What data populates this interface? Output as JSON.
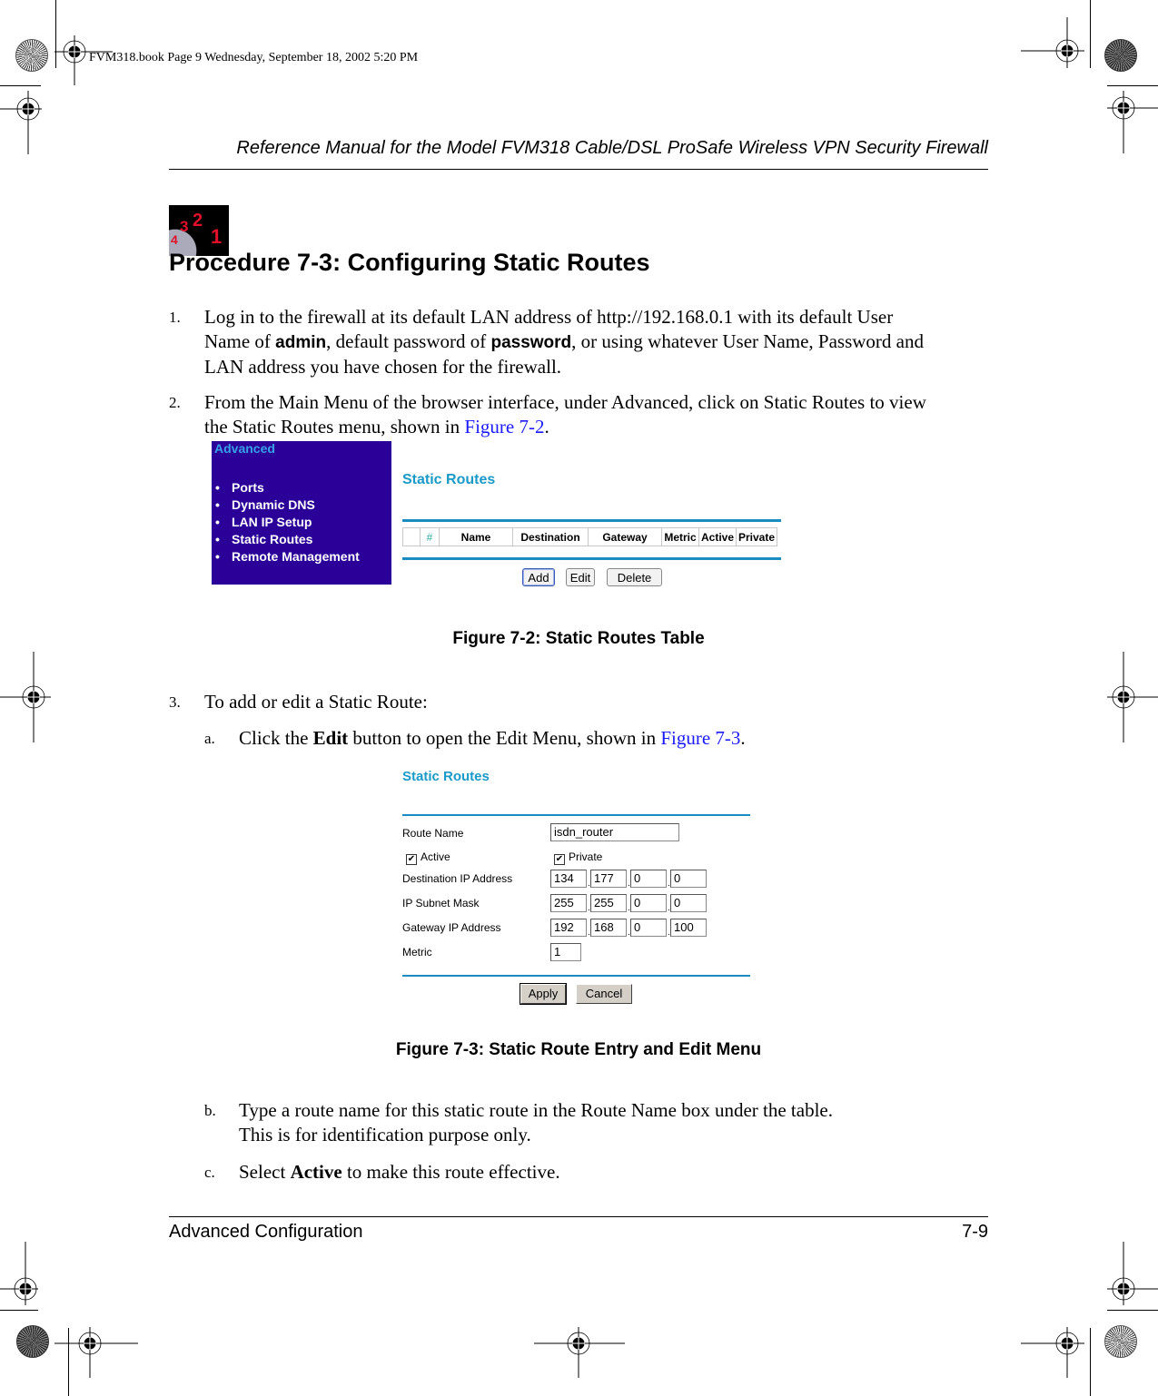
{
  "print_info": "FVM318.book  Page 9  Wednesday, September 18, 2002  5:20 PM",
  "header": {
    "title": "Reference Manual for the Model FVM318 Cable/DSL ProSafe Wireless VPN Security Firewall"
  },
  "procedure": {
    "icon_digits": [
      "4",
      "3",
      "2",
      "1"
    ],
    "title": "Procedure 7-3:  Configuring Static Routes"
  },
  "steps": {
    "s1": {
      "num": "1.",
      "t1": "Log in to the firewall at its default LAN address of http://192.168.0.1 with its default User",
      "t2a": "Name of ",
      "t2b": "admin",
      "t2c": ", default password of ",
      "t2d": "password",
      "t2e": ", or using whatever User Name, Password and",
      "t3": "LAN address you have chosen for the firewall."
    },
    "s2": {
      "num": "2.",
      "t1": "From the Main Menu of the browser interface, under Advanced, click on Static Routes to view",
      "t2a": "the Static Routes menu, shown in ",
      "t2link": "Figure 7-2",
      "t2b": "."
    },
    "s3": {
      "num": "3.",
      "t1": "To add or edit a Static Route:"
    },
    "sa": {
      "num": "a.",
      "t1": "Click the ",
      "t1b": "Edit",
      "t1c": " button to open the Edit Menu, shown in ",
      "link": "Figure 7-3",
      "t1d": "."
    },
    "sb": {
      "num": "b.",
      "t1": "Type a route name for this static route in the Route Name box under the table.",
      "t2": "This is for identification purpose only."
    },
    "sc": {
      "num": "c.",
      "t1": "Select ",
      "t1b": "Active",
      "t1c": " to make this route effective."
    }
  },
  "figure_7_2": {
    "menu_title": "Advanced",
    "menu_items": [
      "Ports",
      "Dynamic DNS",
      "LAN IP Setup",
      "Static Routes",
      "Remote Management"
    ],
    "panel_title": "Static Routes",
    "columns": [
      "",
      "#",
      "Name",
      "Destination",
      "Gateway",
      "Metric",
      "Active",
      "Private"
    ],
    "buttons": {
      "add": "Add",
      "edit": "Edit",
      "delete": "Delete"
    },
    "caption": "Figure 7-2: Static Routes Table"
  },
  "figure_7_3": {
    "panel_title": "Static Routes",
    "route_name_label": "Route Name",
    "route_name_value": "isdn_router",
    "active_label": "Active",
    "active_checked": true,
    "private_label": "Private",
    "private_checked": true,
    "dest_label": "Destination IP Address",
    "dest": [
      "134",
      "177",
      "0",
      "0"
    ],
    "mask_label": "IP Subnet Mask",
    "mask": [
      "255",
      "255",
      "0",
      "0"
    ],
    "gw_label": "Gateway IP Address",
    "gw": [
      "192",
      "168",
      "0",
      "100"
    ],
    "metric_label": "Metric",
    "metric": "1",
    "apply": "Apply",
    "cancel": "Cancel",
    "caption": "Figure 7-3: Static Route Entry and Edit Menu",
    "check_glyph": "✔"
  },
  "footer": {
    "section": "Advanced Configuration",
    "page": "7-9"
  }
}
